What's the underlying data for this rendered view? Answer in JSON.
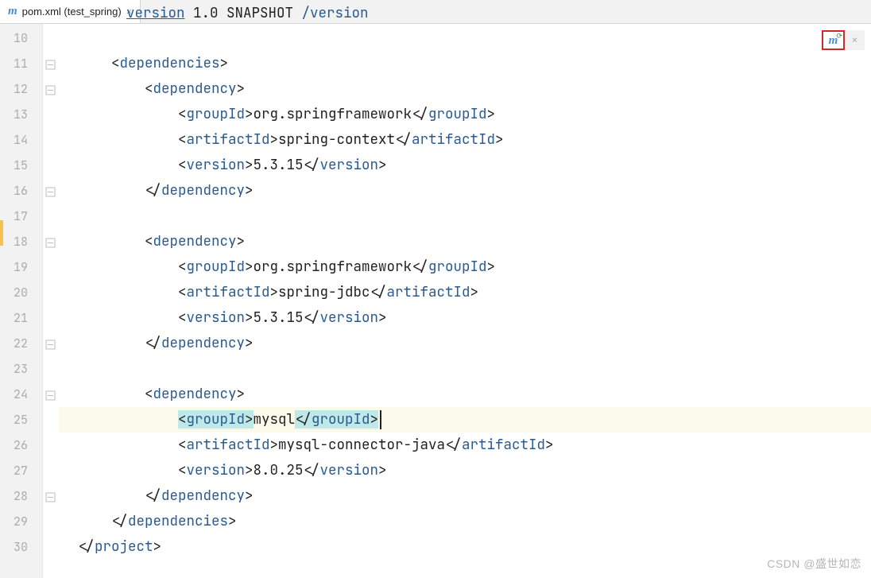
{
  "tab": {
    "filename": "pom.xml (test_spring)"
  },
  "watermark": "CSDN @盛世如恋",
  "gutter": {
    "start": 10,
    "end": 30
  },
  "truncated_line": {
    "a": "version",
    "b": " 1.0 SNAPSHOT",
    "c": "version"
  },
  "code": {
    "l10": "",
    "l11": {
      "tag": "dependencies",
      "indent": 4
    },
    "l12": {
      "tag": "dependency",
      "indent": 8,
      "open": true
    },
    "l13": {
      "tag": "groupId",
      "val": "org.springframework",
      "indent": 12
    },
    "l14": {
      "tag": "artifactId",
      "val": "spring-context",
      "indent": 12
    },
    "l15": {
      "tag": "version",
      "val": "5.3.15",
      "indent": 12
    },
    "l16": {
      "tag": "dependency",
      "indent": 8,
      "close": true
    },
    "l17": "",
    "l18": {
      "tag": "dependency",
      "indent": 8,
      "open": true
    },
    "l19": {
      "tag": "groupId",
      "val": "org.springframework",
      "indent": 12
    },
    "l20": {
      "tag": "artifactId",
      "val": "spring-jdbc",
      "indent": 12
    },
    "l21": {
      "tag": "version",
      "val": "5.3.15",
      "indent": 12
    },
    "l22": {
      "tag": "dependency",
      "indent": 8,
      "close": true
    },
    "l23": "",
    "l24": {
      "tag": "dependency",
      "indent": 8,
      "open": true
    },
    "l25": {
      "tag": "groupId",
      "val": "mysql",
      "indent": 12,
      "highlight": true,
      "selected": true,
      "caret": true
    },
    "l26": {
      "tag": "artifactId",
      "val": "mysql-connector-java",
      "indent": 12
    },
    "l27": {
      "tag": "version",
      "val": "8.0.25",
      "indent": 12
    },
    "l28": {
      "tag": "dependency",
      "indent": 8,
      "close": true
    },
    "l29": {
      "tag": "dependencies",
      "indent": 4,
      "close": true
    },
    "l30": {
      "tag": "project",
      "indent": 0,
      "close": true
    }
  },
  "fold_markers": [
    11,
    12,
    16,
    18,
    22,
    24,
    28
  ]
}
